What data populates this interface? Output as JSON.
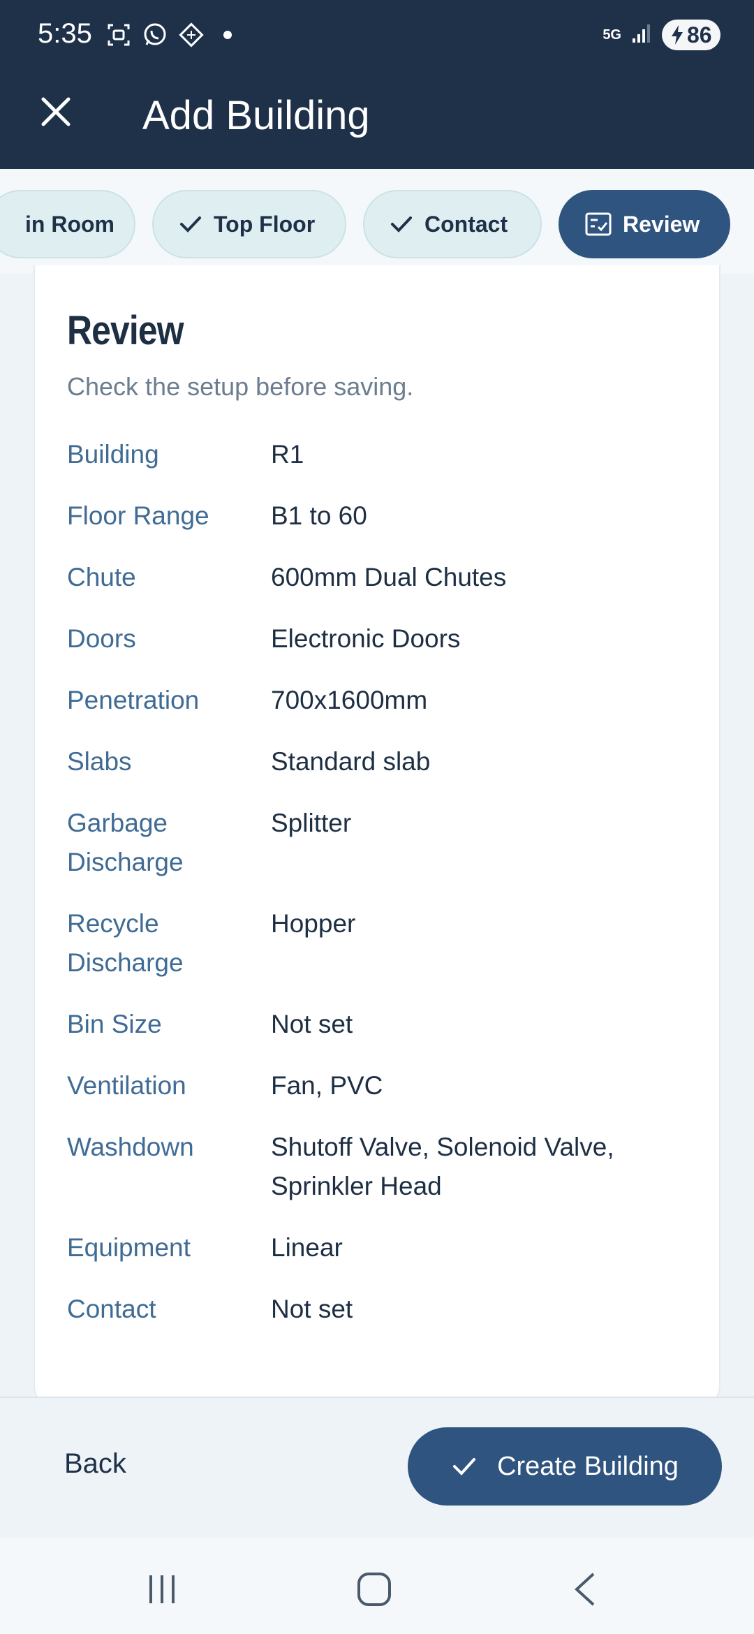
{
  "status_bar": {
    "time": "5:35",
    "network": "5G",
    "battery": "86"
  },
  "toolbar": {
    "title": "Add Building"
  },
  "steps": [
    {
      "label": "in Room",
      "state": "partial"
    },
    {
      "label": "Top Floor",
      "state": "done"
    },
    {
      "label": "Contact",
      "state": "done"
    },
    {
      "label": "Review",
      "state": "active"
    }
  ],
  "review": {
    "title": "Review",
    "subtitle": "Check the setup before saving.",
    "rows": [
      {
        "label": "Building",
        "value": "R1"
      },
      {
        "label": "Floor Range",
        "value": "B1 to 60"
      },
      {
        "label": "Chute",
        "value": "600mm Dual Chutes"
      },
      {
        "label": "Doors",
        "value": "Electronic Doors"
      },
      {
        "label": "Penetration",
        "value": "700x1600mm"
      },
      {
        "label": "Slabs",
        "value": "Standard slab"
      },
      {
        "label": "Garbage Discharge",
        "value": "Splitter"
      },
      {
        "label": "Recycle Discharge",
        "value": "Hopper"
      },
      {
        "label": "Bin Size",
        "value": "Not set"
      },
      {
        "label": "Ventilation",
        "value": "Fan, PVC"
      },
      {
        "label": "Washdown",
        "value": "Shutoff Valve, Solenoid Valve, Sprinkler Head"
      },
      {
        "label": "Equipment",
        "value": "Linear"
      },
      {
        "label": "Contact",
        "value": "Not set"
      }
    ]
  },
  "actions": {
    "back_label": "Back",
    "create_label": "Create Building"
  },
  "colors": {
    "header_bg": "#1e3149",
    "accent": "#2f5480",
    "label": "#3f6b95",
    "step_bg": "#dfeef0"
  }
}
